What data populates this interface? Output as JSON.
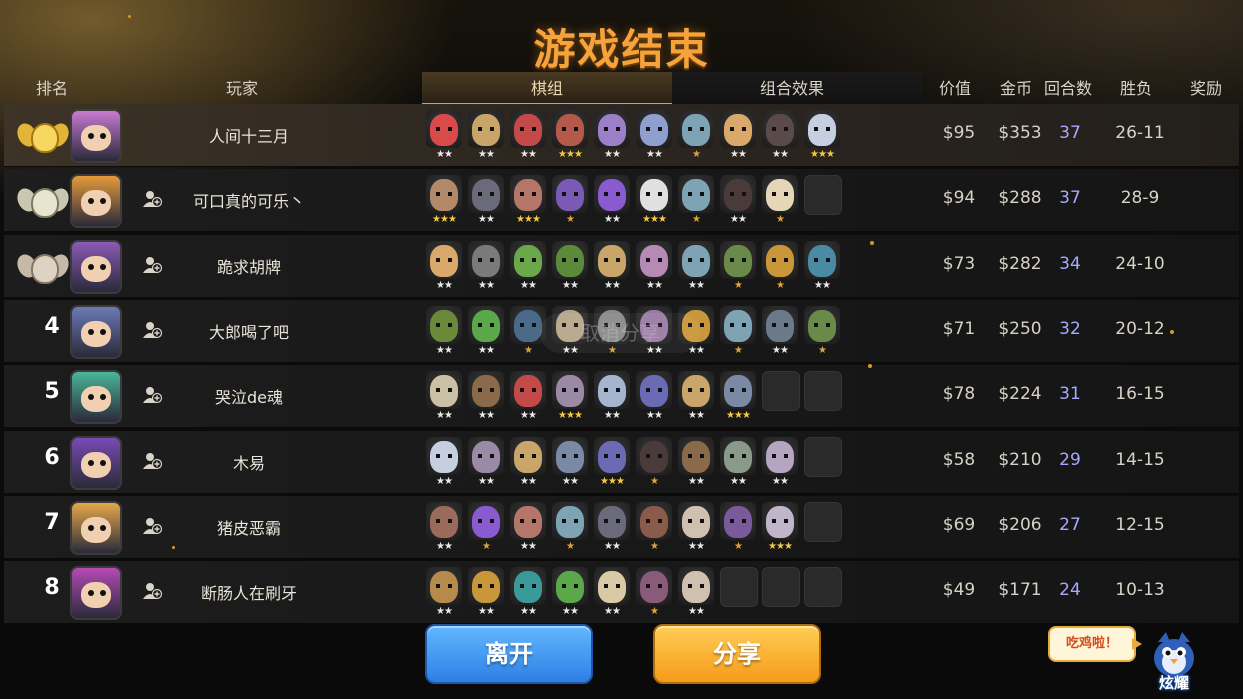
{
  "title": "游戏结束",
  "headers": {
    "rank": "排名",
    "player": "玩家",
    "lineup_tab": "棋组",
    "synergy_tab": "组合效果",
    "value": "价值",
    "gold": "金币",
    "rounds": "回合数",
    "win_loss": "胜负",
    "reward": "奖励"
  },
  "watermark": "取消分享",
  "buttons": {
    "leave": "离开",
    "share": "分享"
  },
  "brag": {
    "bubble": "吃鸡啦！",
    "label": "炫耀"
  },
  "colors": {
    "title": "#f5a33a",
    "rounds_text": "#a8a9ff",
    "leave_button": "#2e7fe3",
    "share_button": "#f59b1b"
  },
  "rows": [
    {
      "rank": "1",
      "medal": "gold",
      "avatar_color": "#c77bd0",
      "name": "人间十三月",
      "value": "$95",
      "gold": "$353",
      "rounds": "37",
      "win_loss": "26-11",
      "pieces": [
        {
          "color": "#d94a4a",
          "stars": "★★"
        },
        {
          "color": "#c9a56a",
          "stars": "★★"
        },
        {
          "color": "#c44a4a",
          "stars": "★★"
        },
        {
          "color": "#b55a4a",
          "stars": "★★★"
        },
        {
          "color": "#9b7fc9",
          "stars": "★★"
        },
        {
          "color": "#8f9fd0",
          "stars": "★★"
        },
        {
          "color": "#7ea3b5",
          "stars": "★"
        },
        {
          "color": "#d9a86a",
          "stars": "★★"
        },
        {
          "color": "#5a4a4a",
          "stars": "★★"
        },
        {
          "color": "#c6cfe0",
          "stars": "★★★"
        }
      ]
    },
    {
      "rank": "2",
      "medal": "silver",
      "avatar_color": "#e59a3a",
      "name": "可口真的可乐丶",
      "value": "$94",
      "gold": "$288",
      "rounds": "37",
      "win_loss": "28-9",
      "pieces": [
        {
          "color": "#b28a6a",
          "stars": "★★★"
        },
        {
          "color": "#6a6a7a",
          "stars": "★★"
        },
        {
          "color": "#b5766a",
          "stars": "★★★"
        },
        {
          "color": "#7a5ab5",
          "stars": "★"
        },
        {
          "color": "#8a5ad0",
          "stars": "★★"
        },
        {
          "color": "#e0e0e0",
          "stars": "★★★"
        },
        {
          "color": "#7ea3b5",
          "stars": "★"
        },
        {
          "color": "#4a3a3a",
          "stars": "★★"
        },
        {
          "color": "#e6d6b8",
          "stars": "★"
        },
        {
          "color": "",
          "stars": ""
        }
      ]
    },
    {
      "rank": "3",
      "medal": "bronze",
      "avatar_color": "#8a5ab5",
      "name": "跪求胡牌",
      "value": "$73",
      "gold": "$282",
      "rounds": "34",
      "win_loss": "24-10",
      "pieces": [
        {
          "color": "#d9a86a",
          "stars": "★★"
        },
        {
          "color": "#7a7a7a",
          "stars": "★★"
        },
        {
          "color": "#6aa84a",
          "stars": "★★"
        },
        {
          "color": "#5a8a3a",
          "stars": "★★"
        },
        {
          "color": "#c9a56a",
          "stars": "★★"
        },
        {
          "color": "#b58ab5",
          "stars": "★★"
        },
        {
          "color": "#7ea3b5",
          "stars": "★★"
        },
        {
          "color": "#6a8a4a",
          "stars": "★"
        },
        {
          "color": "#c9963a",
          "stars": "★"
        },
        {
          "color": "#4a8aa5",
          "stars": "★★"
        }
      ]
    },
    {
      "rank": "4",
      "medal": "",
      "avatar_color": "#6a7ab5",
      "name": "大郎喝了吧",
      "value": "$71",
      "gold": "$250",
      "rounds": "32",
      "win_loss": "20-12",
      "pieces": [
        {
          "color": "#6a8a3a",
          "stars": "★★"
        },
        {
          "color": "#5aa84a",
          "stars": "★★"
        },
        {
          "color": "#4a6a8a",
          "stars": "★"
        },
        {
          "color": "#b5a58a",
          "stars": "★★"
        },
        {
          "color": "#8a8a8a",
          "stars": "★"
        },
        {
          "color": "#9a7aa5",
          "stars": "★★"
        },
        {
          "color": "#c9963a",
          "stars": "★★"
        },
        {
          "color": "#7ea3b5",
          "stars": "★"
        },
        {
          "color": "#6a7a8a",
          "stars": "★★"
        },
        {
          "color": "#6a8a4a",
          "stars": "★"
        }
      ]
    },
    {
      "rank": "5",
      "medal": "",
      "avatar_color": "#4ab59a",
      "name": "哭泣de魂",
      "value": "$78",
      "gold": "$224",
      "rounds": "31",
      "win_loss": "16-15",
      "pieces": [
        {
          "color": "#c9c0a5",
          "stars": "★★"
        },
        {
          "color": "#8a6a4a",
          "stars": "★★"
        },
        {
          "color": "#c44a4a",
          "stars": "★★"
        },
        {
          "color": "#9a8aa5",
          "stars": "★★★"
        },
        {
          "color": "#a5b5d0",
          "stars": "★★"
        },
        {
          "color": "#6a6ab5",
          "stars": "★★"
        },
        {
          "color": "#c9a56a",
          "stars": "★★"
        },
        {
          "color": "#7a8aa5",
          "stars": "★★★"
        },
        {
          "color": "",
          "stars": ""
        },
        {
          "color": "",
          "stars": ""
        }
      ]
    },
    {
      "rank": "6",
      "medal": "",
      "avatar_color": "#7a4ab5",
      "name": "木易",
      "value": "$58",
      "gold": "$210",
      "rounds": "29",
      "win_loss": "14-15",
      "pieces": [
        {
          "color": "#c6cfe0",
          "stars": "★★"
        },
        {
          "color": "#9a8aa5",
          "stars": "★★"
        },
        {
          "color": "#c9a56a",
          "stars": "★★"
        },
        {
          "color": "#7a8aa5",
          "stars": "★★"
        },
        {
          "color": "#6a6ab5",
          "stars": "★★★"
        },
        {
          "color": "#4a3a3a",
          "stars": "★"
        },
        {
          "color": "#8a6a4a",
          "stars": "★★"
        },
        {
          "color": "#8a9a8a",
          "stars": "★★"
        },
        {
          "color": "#b5a5c0",
          "stars": "★★"
        },
        {
          "color": "",
          "stars": ""
        }
      ]
    },
    {
      "rank": "7",
      "medal": "",
      "avatar_color": "#e5a84a",
      "name": "猪皮恶霸",
      "value": "$69",
      "gold": "$206",
      "rounds": "27",
      "win_loss": "12-15",
      "pieces": [
        {
          "color": "#9a6a5a",
          "stars": "★★"
        },
        {
          "color": "#8a5ad0",
          "stars": "★"
        },
        {
          "color": "#b5766a",
          "stars": "★★"
        },
        {
          "color": "#7ea3b5",
          "stars": "★"
        },
        {
          "color": "#6a6a7a",
          "stars": "★★"
        },
        {
          "color": "#8a5a4a",
          "stars": "★"
        },
        {
          "color": "#d0c0b0",
          "stars": "★★"
        },
        {
          "color": "#7a5a9a",
          "stars": "★"
        },
        {
          "color": "#c0b5c9",
          "stars": "★★★"
        },
        {
          "color": "",
          "stars": ""
        }
      ]
    },
    {
      "rank": "8",
      "medal": "",
      "avatar_color": "#b54ab5",
      "name": "断肠人在刷牙",
      "value": "$49",
      "gold": "$171",
      "rounds": "24",
      "win_loss": "10-13",
      "pieces": [
        {
          "color": "#b58a4a",
          "stars": "★★"
        },
        {
          "color": "#c9963a",
          "stars": "★★"
        },
        {
          "color": "#3a9a9a",
          "stars": "★★"
        },
        {
          "color": "#5aa84a",
          "stars": "★★"
        },
        {
          "color": "#d9c9a5",
          "stars": "★★"
        },
        {
          "color": "#8a5a7a",
          "stars": "★"
        },
        {
          "color": "#d0c0b0",
          "stars": "★★"
        },
        {
          "color": "",
          "stars": ""
        },
        {
          "color": "",
          "stars": ""
        },
        {
          "color": "",
          "stars": ""
        }
      ]
    }
  ]
}
